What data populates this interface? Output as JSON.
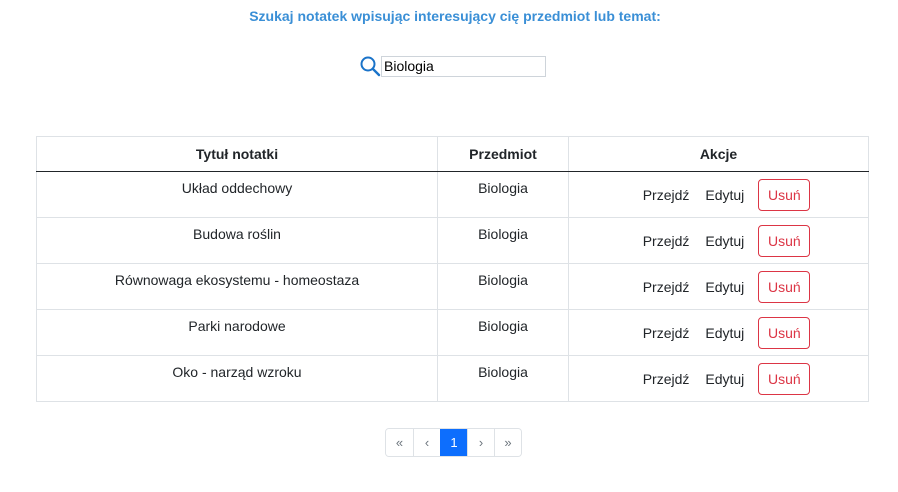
{
  "search": {
    "heading": "Szukaj notatek wpisując interesujący cię przedmiot lub temat:",
    "value": "Biologia",
    "icon": "search-icon"
  },
  "table": {
    "headers": {
      "title": "Tytuł notatki",
      "subject": "Przedmiot",
      "actions": "Akcje"
    },
    "rows": [
      {
        "title": "Układ oddechowy",
        "subject": "Biologia",
        "open": "Przejdź",
        "edit": "Edytuj",
        "delete": "Usuń"
      },
      {
        "title": "Budowa roślin",
        "subject": "Biologia",
        "open": "Przejdź",
        "edit": "Edytuj",
        "delete": "Usuń"
      },
      {
        "title": "Równowaga ekosystemu - homeostaza",
        "subject": "Biologia",
        "open": "Przejdź",
        "edit": "Edytuj",
        "delete": "Usuń"
      },
      {
        "title": "Parki narodowe",
        "subject": "Biologia",
        "open": "Przejdź",
        "edit": "Edytuj",
        "delete": "Usuń"
      },
      {
        "title": "Oko - narząd wzroku",
        "subject": "Biologia",
        "open": "Przejdź",
        "edit": "Edytuj",
        "delete": "Usuń"
      }
    ]
  },
  "pagination": {
    "first": "«",
    "prev": "‹",
    "current": "1",
    "next": "›",
    "last": "»"
  },
  "colors": {
    "heading": "#3a8fd6",
    "delete": "#dc3545",
    "active_page": "#0d6efd"
  }
}
